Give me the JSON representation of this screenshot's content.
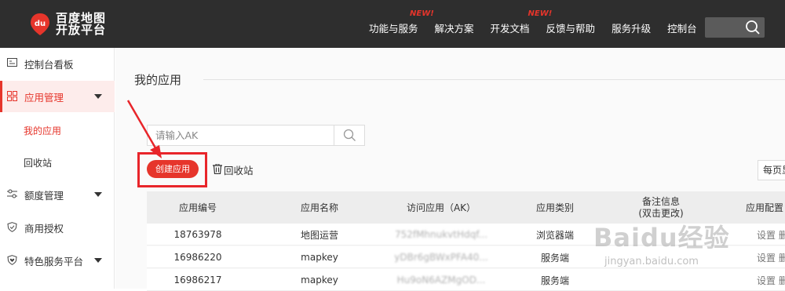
{
  "header": {
    "logo": {
      "line1": "百度地图",
      "line2": "开放平台",
      "mark": "du"
    },
    "nav": [
      {
        "label": "功能与服务",
        "badge": "NEW!"
      },
      {
        "label": "解决方案",
        "badge": ""
      },
      {
        "label": "开发文档",
        "badge": "NEW!"
      },
      {
        "label": "反馈与帮助",
        "badge": ""
      },
      {
        "label": "服务升级",
        "badge": ""
      },
      {
        "label": "控制台",
        "badge": ""
      }
    ],
    "search_icon": "search-icon"
  },
  "sidebar": {
    "items": [
      {
        "label": "控制台看板",
        "icon": "dashboard-icon",
        "expandable": false
      },
      {
        "label": "应用管理",
        "icon": "grid-icon",
        "expandable": true,
        "active": true
      },
      {
        "label": "额度管理",
        "icon": "sliders-icon",
        "expandable": true
      },
      {
        "label": "商用授权",
        "icon": "shield-check-icon",
        "expandable": false
      },
      {
        "label": "特色服务平台",
        "icon": "heart-shield-icon",
        "expandable": true
      }
    ],
    "sub_items": [
      {
        "label": "我的应用",
        "active": true
      },
      {
        "label": "回收站",
        "active": false
      }
    ]
  },
  "main": {
    "title": "我的应用",
    "search_placeholder": "请输入AK",
    "create_button": "创建应用",
    "recycle_link": "回收站",
    "per_page_label": "每页显示",
    "table": {
      "headers": [
        "应用编号",
        "应用名称",
        "访问应用（AK）",
        "应用类别",
        "备注信息\n(双击更改)",
        "应用配置"
      ],
      "rows": [
        {
          "id": "18763978",
          "name": "地图运营",
          "ak": "752fMhnukvtHdqf...",
          "type": "浏览器端",
          "note": "",
          "ops": "设置 删除"
        },
        {
          "id": "16986220",
          "name": "mapkey",
          "ak": "yDBr6gBWxPFA40...",
          "type": "服务端",
          "note": "",
          "ops": "设置 删除"
        },
        {
          "id": "16986217",
          "name": "mapkey",
          "ak": "Hu9oN6AZMgOD...",
          "type": "服务端",
          "note": "",
          "ops": "设置 删除"
        }
      ]
    }
  },
  "watermark": {
    "text": "Baidu经验",
    "url": "jingyan.baidu.com"
  },
  "colors": {
    "brand_red": "#e6352b",
    "topbar": "#2e2e2e",
    "annotation": "#e8252a"
  }
}
